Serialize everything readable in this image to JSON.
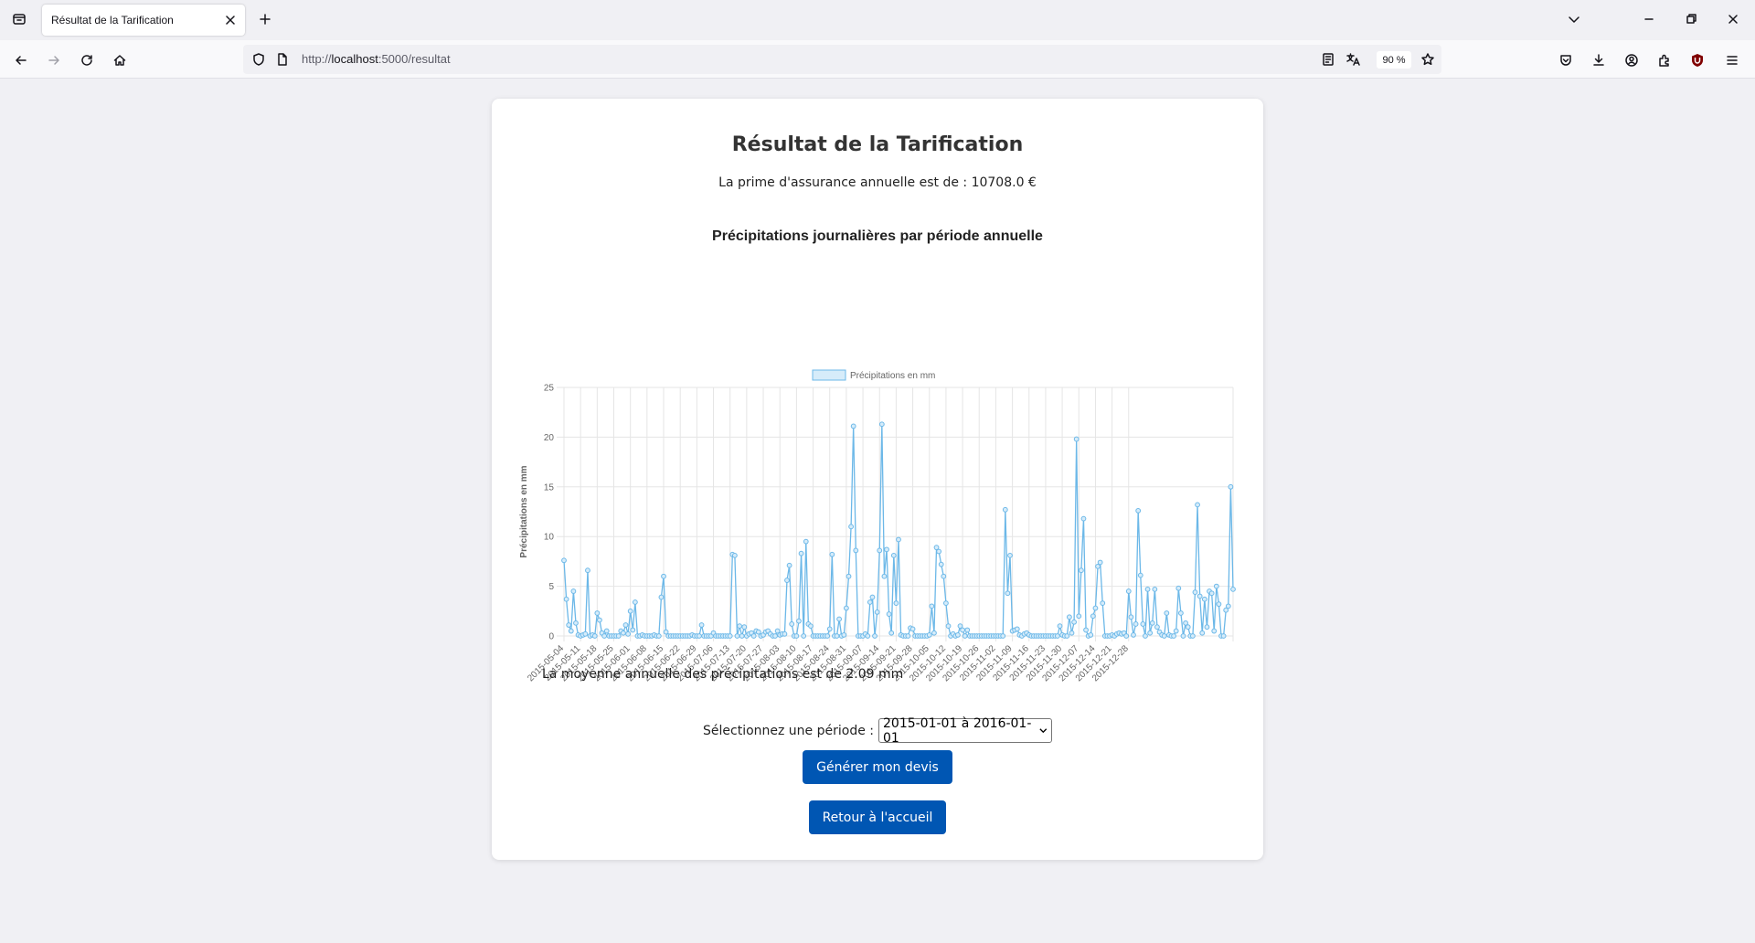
{
  "browser": {
    "tab_title": "Résultat de la Tarification",
    "url_prefix": "http://",
    "url_host": "localhost",
    "url_path": ":5000/resultat",
    "zoom": "90 %"
  },
  "page": {
    "title": "Résultat de la Tarification",
    "premium_text": "La prime d'assurance annuelle est de : 10708.0 €",
    "average_text": "La moyenne annuelle des précipitations est de 2.09 mm",
    "period_label": "Sélectionnez une période :",
    "period_selected": "2015-01-01 à 2016-01-01",
    "generate_button": "Générer mon devis",
    "home_button": "Retour à l'accueil"
  },
  "colors": {
    "accent_button": "#0056b3",
    "line": "#6cb8e8",
    "legend_fill": "#d6ecfa"
  },
  "icons": [
    "tab-list-icon",
    "close-icon",
    "plus-icon",
    "chevron-down-icon",
    "minimize-icon",
    "restore-icon",
    "back-icon",
    "forward-icon",
    "reload-icon",
    "home-icon",
    "shield-icon",
    "page-icon",
    "reader-icon",
    "translate-icon",
    "star-icon",
    "pocket-icon",
    "download-icon",
    "account-icon",
    "extensions-icon",
    "ublock-icon",
    "menu-icon"
  ],
  "chart_data": {
    "type": "line",
    "title": "Précipitations journalières par période annuelle",
    "ylabel": "Précipitations en mm",
    "xlabel": "",
    "ylim": [
      0,
      25
    ],
    "yticks": [
      0,
      5,
      10,
      15,
      20,
      25
    ],
    "grid": true,
    "legend_position": "top",
    "x_tick_labels": [
      "2015-05-04",
      "2015-05-11",
      "2015-05-18",
      "2015-05-25",
      "2015-06-01",
      "2015-06-08",
      "2015-06-15",
      "2015-06-22",
      "2015-06-29",
      "2015-07-06",
      "2015-07-13",
      "2015-07-20",
      "2015-07-27",
      "2015-08-03",
      "2015-08-10",
      "2015-08-17",
      "2015-08-24",
      "2015-08-31",
      "2015-09-07",
      "2015-09-14",
      "2015-09-21",
      "2015-09-28",
      "2015-10-05",
      "2015-10-12",
      "2015-10-19",
      "2015-10-26",
      "2015-11-02",
      "2015-11-09",
      "2015-11-16",
      "2015-11-23",
      "2015-11-30",
      "2015-12-07",
      "2015-12-14",
      "2015-12-21",
      "2015-12-28"
    ],
    "series": [
      {
        "name": "Précipitations en mm",
        "x_start": "2015-05-04",
        "values": [
          7.6,
          3.7,
          1.1,
          0.5,
          4.5,
          1.3,
          0.1,
          0,
          0.1,
          0.2,
          6.6,
          0,
          0.1,
          0,
          2.3,
          1.6,
          0.3,
          0,
          0.5,
          0,
          0,
          0,
          0,
          0,
          0.5,
          0.3,
          1.1,
          0.2,
          2.5,
          0.6,
          3.4,
          0,
          0,
          0.1,
          0,
          0,
          0,
          0,
          0.1,
          0,
          0,
          3.9,
          6,
          0.4,
          0,
          0,
          0,
          0,
          0,
          0,
          0,
          0,
          0,
          0,
          0.1,
          0,
          0,
          0,
          1.1,
          0,
          0,
          0,
          0,
          0.3,
          0,
          0,
          0,
          0,
          0,
          0,
          0,
          8.2,
          8.1,
          0,
          1,
          0,
          0.9,
          0,
          0.2,
          0.3,
          0,
          0.5,
          0.4,
          0,
          0.1,
          0.4,
          0.5,
          0.2,
          0,
          0,
          0.5,
          0.1,
          0.2,
          0.2,
          5.6,
          7.1,
          1.2,
          0,
          0,
          1.5,
          8.3,
          0,
          9.5,
          1.2,
          1,
          0,
          0,
          0,
          0,
          0,
          0,
          0,
          0.7,
          8.2,
          0,
          0,
          1.7,
          0,
          0.1,
          2.8,
          6,
          11,
          21.1,
          8.6,
          0,
          0,
          0,
          0.2,
          0,
          3.4,
          3.9,
          0,
          2.4,
          8.6,
          21.3,
          6,
          8.7,
          2.2,
          0.3,
          8.1,
          3.3,
          9.7,
          0.1,
          0,
          0,
          0,
          0.8,
          0.7,
          0,
          0,
          0,
          0,
          0,
          0,
          0.1,
          3,
          0.3,
          8.9,
          8.5,
          7.2,
          6,
          3.3,
          1,
          0,
          0.2,
          0,
          0.1,
          1,
          0.6,
          0,
          0.6,
          0,
          0,
          0,
          0,
          0,
          0,
          0,
          0,
          0,
          0,
          0,
          0,
          0,
          0,
          0,
          12.7,
          4.3,
          8.1,
          0.5,
          0.6,
          0.7,
          0.1,
          0,
          0.2,
          0.3,
          0.1,
          0,
          0,
          0,
          0,
          0,
          0,
          0,
          0,
          0,
          0,
          0,
          0,
          1,
          0.1,
          0,
          0,
          1.9,
          0.3,
          1.4,
          19.8,
          2,
          6.6,
          11.8,
          0.6,
          0,
          0.1,
          2,
          2.8,
          7,
          7.4,
          3.3,
          0,
          0,
          0,
          0.1,
          0,
          0.2,
          0.3,
          0.2,
          0.3,
          0,
          4.5,
          1.9,
          0.1,
          1.2,
          12.6,
          6.1,
          1.2,
          0,
          4.7,
          0.3,
          1.3,
          4.7,
          0.9,
          0.4,
          0.1,
          0,
          2.3,
          0.1,
          0,
          0,
          0.5,
          4.8,
          2.3,
          0,
          1.3,
          0.9,
          0,
          0,
          4.4,
          13.2,
          4,
          0.3,
          3.7,
          0.9,
          4.5,
          4.3,
          0.5,
          5,
          3.2,
          0,
          0,
          2.6,
          3,
          15,
          4.7
        ]
      }
    ]
  }
}
